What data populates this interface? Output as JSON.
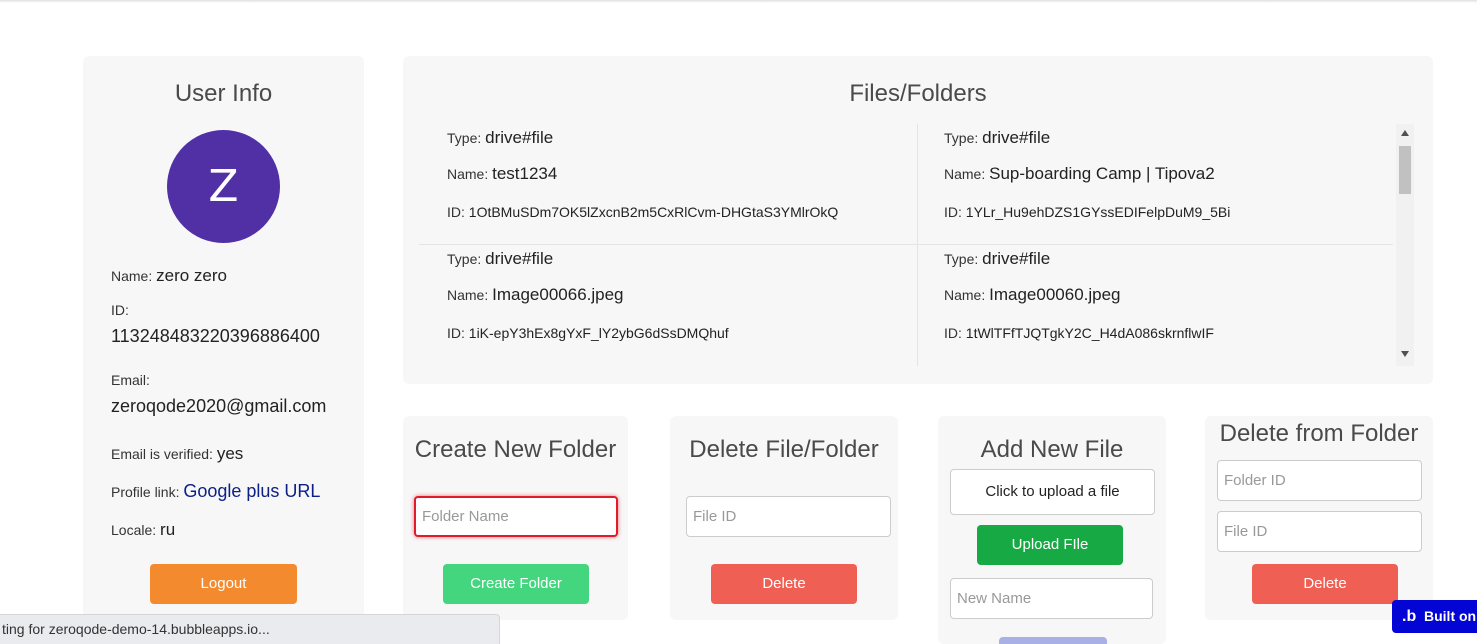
{
  "user_info": {
    "title": "User Info",
    "avatar_letter": "Z",
    "name_label": "Name:",
    "name_value": "zero zero",
    "id_label": "ID:",
    "id_value": "113248483220396886400",
    "email_label": "Email:",
    "email_value": "zeroqode2020@gmail.com",
    "verified_label": "Email is verified:",
    "verified_value": "yes",
    "profile_label": "Profile link:",
    "profile_value": "Google plus URL",
    "locale_label": "Locale:",
    "locale_value": "ru",
    "logout_label": "Logout"
  },
  "files": {
    "title": "Files/Folders",
    "type_label": "Type:",
    "name_label": "Name:",
    "id_label": "ID:",
    "items": [
      {
        "type": "drive#file",
        "name": "test1234",
        "id": "1OtBMuSDm7OK5lZxcnB2m5CxRlCvm-DHGtaS3YMlrOkQ"
      },
      {
        "type": "drive#file",
        "name": "Sup-boarding Camp | Tipova2",
        "id": "1YLr_Hu9ehDZS1GYssEDIFelpDuM9_5Bi"
      },
      {
        "type": "drive#file",
        "name": "Image00066.jpeg",
        "id": "1iK-epY3hEx8gYxF_lY2ybG6dSsDMQhuf"
      },
      {
        "type": "drive#file",
        "name": "Image00060.jpeg",
        "id": "1tWlTFfTJQTgkY2C_H4dA086skrnflwIF"
      }
    ]
  },
  "create_folder": {
    "title": "Create New Folder",
    "placeholder": "Folder Name",
    "button": "Create Folder"
  },
  "delete_file": {
    "title": "Delete File/Folder",
    "placeholder": "File ID",
    "button": "Delete"
  },
  "add_file": {
    "title": "Add New File",
    "upload_area": "Click to upload a file",
    "upload_button": "Upload FIle",
    "placeholder": "New Name"
  },
  "delete_from_folder": {
    "title": "Delete from Folder",
    "folder_placeholder": "Folder ID",
    "file_placeholder": "File ID",
    "button": "Delete"
  },
  "status_bar": {
    "text": "ting for zeroqode-demo-14.bubbleapps.io..."
  },
  "badge": {
    "label": "Built on"
  },
  "colors": {
    "avatar": "#5030a4",
    "logout": "#f38a2e",
    "create": "#44d67f",
    "delete": "#ef5f54",
    "upload": "#17aa44",
    "link": "#0b1f87",
    "badge": "#0205d3"
  }
}
